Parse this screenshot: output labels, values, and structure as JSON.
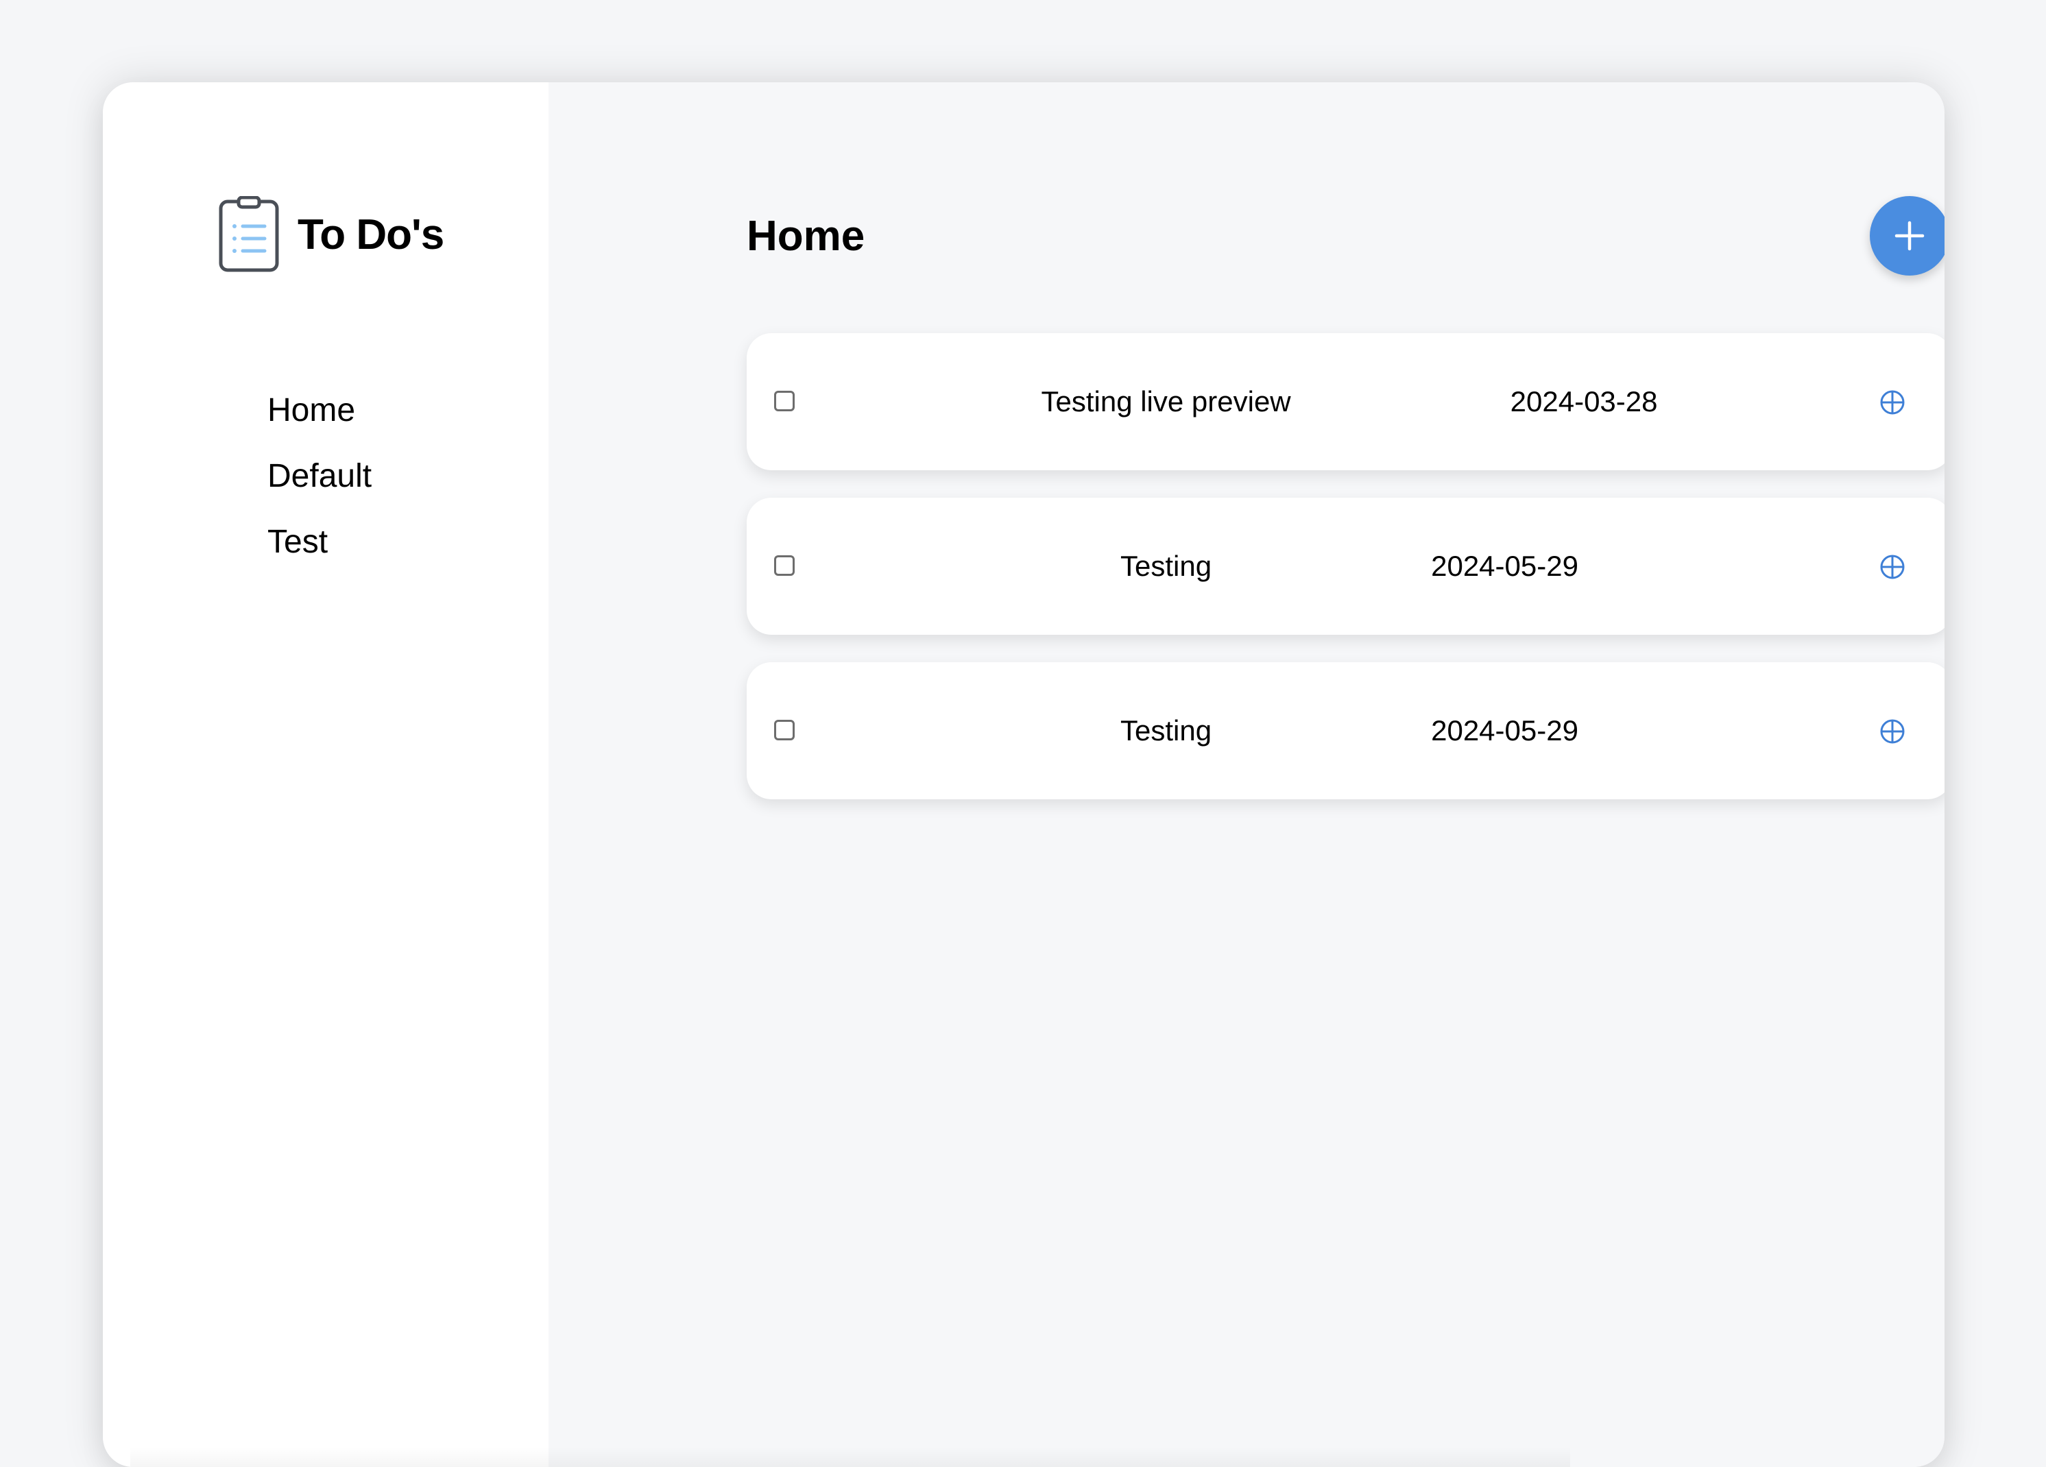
{
  "app": {
    "title": "To Do's"
  },
  "sidebar": {
    "items": [
      {
        "label": "Home"
      },
      {
        "label": "Default"
      },
      {
        "label": "Test"
      }
    ]
  },
  "main": {
    "page_title": "Home",
    "add_button_icon": "plus-icon",
    "tasks": [
      {
        "title": "Testing live preview",
        "date": "2024-03-28",
        "done": false
      },
      {
        "title": "Testing",
        "date": "2024-05-29",
        "done": false
      },
      {
        "title": "Testing",
        "date": "2024-05-29",
        "done": false
      }
    ]
  },
  "colors": {
    "accent": "#4a8de0",
    "background": "#f5f6f8",
    "sidebar": "#ffffff",
    "card": "#ffffff"
  }
}
